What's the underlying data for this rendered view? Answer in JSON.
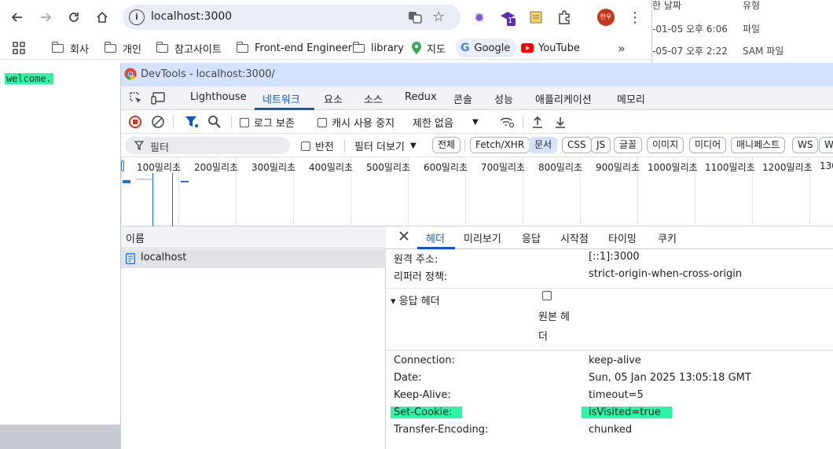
{
  "browser": {
    "url": "localhost:3000",
    "profile_badge": "현우",
    "ext_badge": "1",
    "bookmarks": [
      {
        "label": "회사"
      },
      {
        "label": "개인"
      },
      {
        "label": "참고사이트"
      },
      {
        "label": "Front-end Engineer"
      },
      {
        "label": "library"
      },
      {
        "label": "지도"
      },
      {
        "label": "Google"
      },
      {
        "label": "YouTube"
      }
    ]
  },
  "page": {
    "welcome_text": "welcome."
  },
  "bg_window": {
    "headers": [
      "한 날짜",
      "유형"
    ],
    "rows": [
      {
        "date": "-01-05 오후 6:06",
        "type": "파일"
      },
      {
        "date": "-05-07 오후 2:22",
        "type": "SAM 파일"
      }
    ]
  },
  "devtools": {
    "title": "DevTools - localhost:3000/",
    "tabs": [
      "Lighthouse",
      "네트워크",
      "요소",
      "소스",
      "Redux",
      "콘솔",
      "성능",
      "애플리케이션",
      "메모리"
    ],
    "active_tab": "네트워크",
    "toolbar": {
      "preserve_log": "로그 보존",
      "disable_cache": "캐시 사용 중지",
      "throttle": "제한 없음"
    },
    "filter": {
      "placeholder": "필터",
      "invert": "반전",
      "more_filters": "필터 더보기",
      "chips": [
        "전체",
        "Fetch/XHR",
        "문서",
        "CSS",
        "JS",
        "글꼴",
        "이미지",
        "미디어",
        "매니페스트",
        "WS",
        "W"
      ],
      "active_chip": "문서"
    },
    "timeline_labels": [
      "100밀리초",
      "200밀리초",
      "300밀리초",
      "400밀리초",
      "500밀리초",
      "600밀리초",
      "700밀리초",
      "800밀리초",
      "900밀리초",
      "1000밀리초",
      "1100밀리초",
      "1200밀리초",
      "130"
    ],
    "list": {
      "header": "이름",
      "rows": [
        {
          "name": "localhost"
        }
      ]
    },
    "detail": {
      "tabs": [
        "헤더",
        "미리보기",
        "응답",
        "시작점",
        "타이밍",
        "쿠키"
      ],
      "active_tab": "헤더",
      "general": [
        {
          "name": "원격 주소:",
          "value": "[::1]:3000"
        },
        {
          "name": "리퍼러 정책:",
          "value": "strict-origin-when-cross-origin"
        }
      ],
      "response_section": "▾ 응답 헤더",
      "raw_label_1": "원본 헤",
      "raw_label_2": "더",
      "response_headers": [
        {
          "name": "Connection:",
          "value": "keep-alive"
        },
        {
          "name": "Date:",
          "value": "Sun, 05 Jan 2025 13:05:18 GMT"
        },
        {
          "name": "Keep-Alive:",
          "value": "timeout=5"
        },
        {
          "name": "Set-Cookie:",
          "value": "isVisited=true"
        },
        {
          "name": "Transfer-Encoding:",
          "value": "chunked"
        }
      ]
    }
  }
}
